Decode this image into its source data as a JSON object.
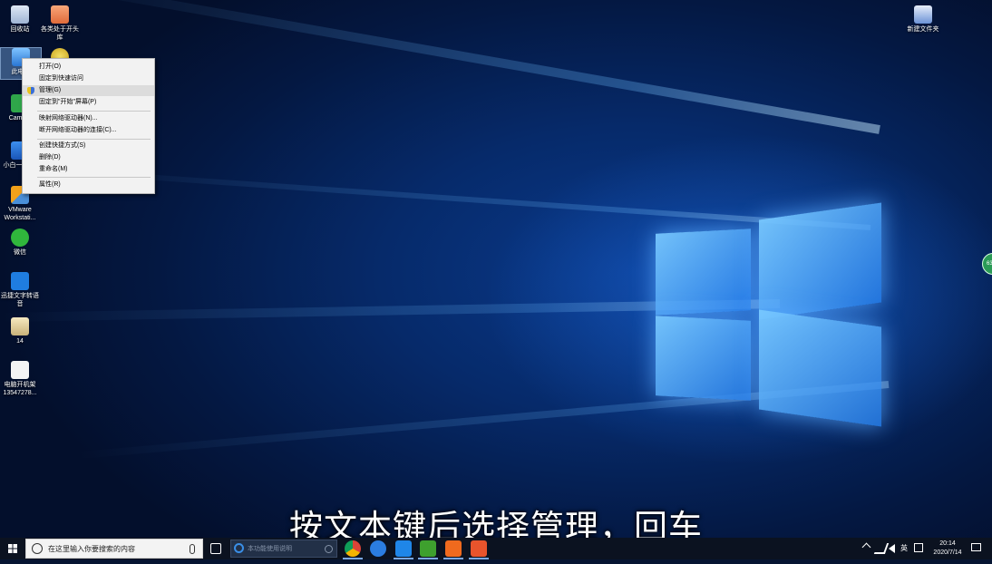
{
  "desktop_icons": {
    "recycle_bin": "回收站",
    "startup_folder": "各类处于开头库",
    "this_pc": "此电脑",
    "camera": "Cam 20",
    "tool": "小白一键 系",
    "vmware": "VMware Workstati...",
    "wechat": "微信",
    "xunjie": "迅捷文字转语音",
    "item14": "14",
    "music_file": "电脑开机架 13547278...",
    "new_folder": "新建文件夹"
  },
  "context_menu": {
    "items": [
      "打开(O)",
      "固定到快速访问",
      "管理(G)",
      "固定到\"开始\"屏幕(P)",
      "映射网络驱动器(N)...",
      "断开网络驱动器的连接(C)...",
      "创建快捷方式(S)",
      "删除(D)",
      "重命名(M)",
      "属性(R)"
    ]
  },
  "subtitle": "按文本键后选择管理，回车",
  "side_widget": "63",
  "taskbar": {
    "search_placeholder": "在这里输入你要搜索的内容",
    "ie_address": "本功能使用说明",
    "tray_lang": "英",
    "clock_time": "20:14",
    "clock_date": "2020/7/14"
  },
  "colors": {
    "wallpaper": "#062a6a",
    "logo_glow": "#78c8ff",
    "menu_bg": "#f2f2f2",
    "menu_highlight": "#dcdcdc",
    "taskbar_bg": "#0b1220"
  }
}
